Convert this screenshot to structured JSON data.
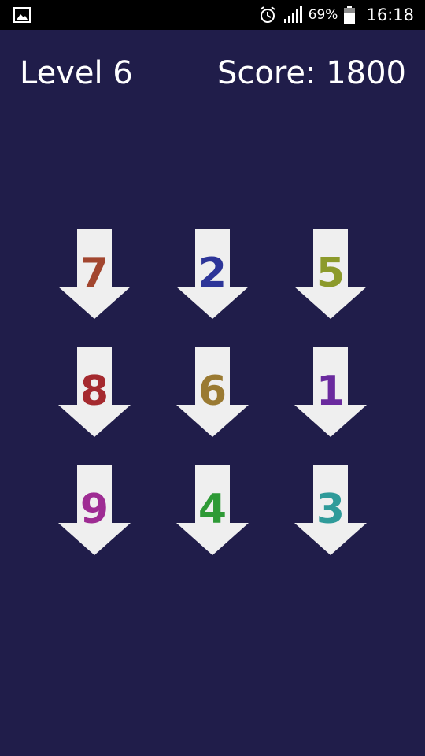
{
  "status_bar": {
    "battery": "69%",
    "time": "16:18",
    "icons": [
      "gallery-icon",
      "alarm-icon",
      "signal-icon",
      "battery-icon"
    ]
  },
  "hud": {
    "level": "Level 6",
    "score": "Score: 1800"
  },
  "grid": {
    "tiles": [
      {
        "number": "7",
        "color": "#a2462f"
      },
      {
        "number": "2",
        "color": "#2d3598"
      },
      {
        "number": "5",
        "color": "#8c9a2b"
      },
      {
        "number": "8",
        "color": "#a52a2f"
      },
      {
        "number": "6",
        "color": "#9a7a32"
      },
      {
        "number": "1",
        "color": "#6a2a9e"
      },
      {
        "number": "9",
        "color": "#9e2c93"
      },
      {
        "number": "4",
        "color": "#2e9a36"
      },
      {
        "number": "3",
        "color": "#2f9b9a"
      }
    ]
  },
  "colors": {
    "background": "#201d4a",
    "arrow": "#efefef"
  }
}
